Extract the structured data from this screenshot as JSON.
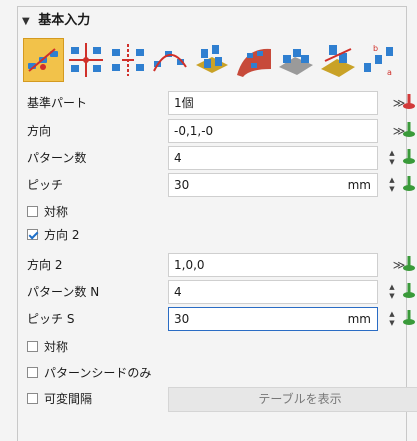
{
  "section": {
    "title": "基本入力",
    "collapse_icon": "triangle-down-icon"
  },
  "toolbar": {
    "icons": [
      "linear-pattern-icon",
      "rectangular-pattern-icon",
      "axial-pattern-icon",
      "curve-pattern-icon",
      "fill-pattern-icon",
      "surface-pattern-icon",
      "along-face-pattern-icon",
      "sketch-pattern-icon",
      "table-pattern-icon"
    ],
    "selected_index": 0
  },
  "rows": {
    "base_part": {
      "label": "基準パート",
      "value": "1個"
    },
    "direction": {
      "label": "方向",
      "value": "-0,1,-0"
    },
    "pattern_count": {
      "label": "パターン数",
      "value": "4"
    },
    "pitch": {
      "label": "ピッチ",
      "value": "30",
      "unit": "mm"
    },
    "symmetric1": {
      "label": "対称",
      "checked": false
    },
    "direction2_toggle": {
      "label": "方向 2",
      "checked": true
    },
    "direction2": {
      "label": "方向 2",
      "value": "1,0,0"
    },
    "pattern_count_n": {
      "label": "パターン数 N",
      "value": "4"
    },
    "pitch_s": {
      "label": "ピッチ S",
      "value": "30",
      "unit": "mm"
    },
    "symmetric2": {
      "label": "対称",
      "checked": false
    },
    "seed_only": {
      "label": "パターンシードのみ",
      "checked": false
    },
    "variable_spacing": {
      "label": "可変間隔",
      "checked": false
    }
  },
  "buttons": {
    "show_table": "テーブルを表示"
  },
  "colors": {
    "accent_selected": "#f2c24a",
    "focus_border": "#2a6cc4",
    "pick_green": "#3a9a3a",
    "pick_red": "#d23a3a"
  }
}
